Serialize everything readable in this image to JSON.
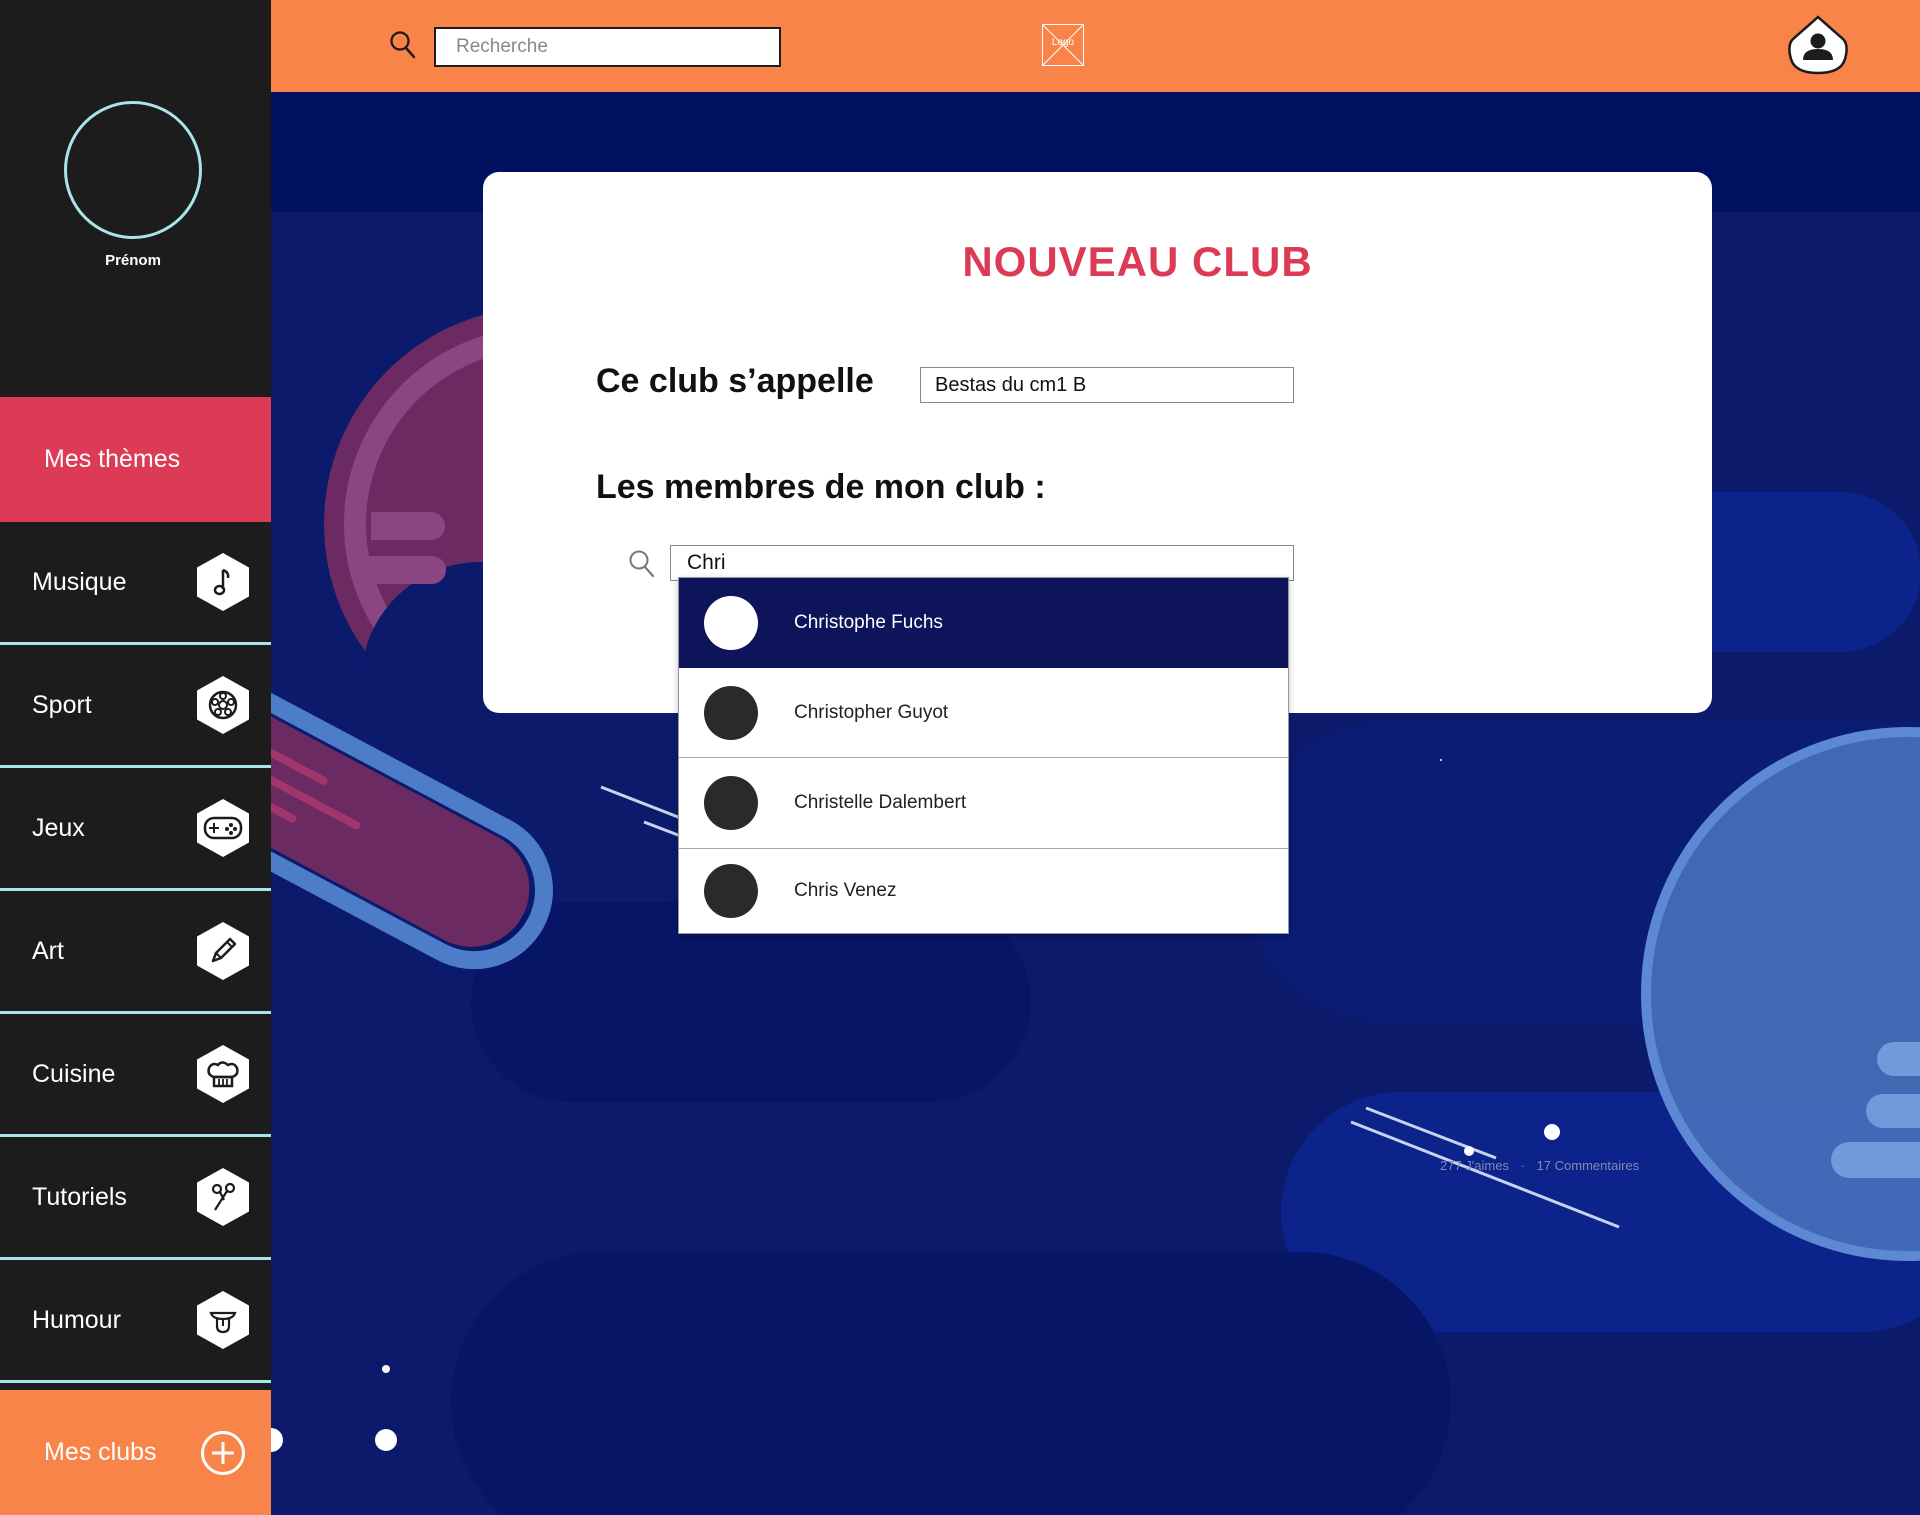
{
  "topbar": {
    "search_placeholder": "Recherche",
    "logo_text": "Logo"
  },
  "sidebar": {
    "user_name": "Prénom",
    "my_themes_label": "Mes thèmes",
    "themes": [
      {
        "label": "Musique",
        "icon": "music-note-icon"
      },
      {
        "label": "Sport",
        "icon": "soccer-ball-icon"
      },
      {
        "label": "Jeux",
        "icon": "gamepad-icon"
      },
      {
        "label": "Art",
        "icon": "pencil-icon"
      },
      {
        "label": "Cuisine",
        "icon": "chef-hat-icon"
      },
      {
        "label": "Tutoriels",
        "icon": "scissors-icon"
      },
      {
        "label": "Humour",
        "icon": "tongue-face-icon"
      }
    ],
    "my_clubs_label": "Mes clubs"
  },
  "card": {
    "title": "Nouveau club",
    "club_name_label": "Ce club s’appelle",
    "club_name_value": "Bestas du cm1 B",
    "members_label": "Les membres de mon club :",
    "member_search_value": "Chri"
  },
  "suggestions": [
    {
      "name": "Christophe Fuchs",
      "highlighted": true
    },
    {
      "name": "Christopher Guyot",
      "highlighted": false
    },
    {
      "name": "Christelle Dalembert",
      "highlighted": false
    },
    {
      "name": "Chris Venez",
      "highlighted": false
    }
  ],
  "background_post": {
    "likes": "277 J'aimes",
    "separator": "·",
    "comments": "17 Commentaires"
  },
  "colors": {
    "orange": "#f98449",
    "red": "#dc3a55",
    "sidebar_bg": "#1c1c1c",
    "accent_cyan": "#a9e4ea",
    "navy": "#0d1459",
    "background_blue": "#0c1a6b"
  }
}
